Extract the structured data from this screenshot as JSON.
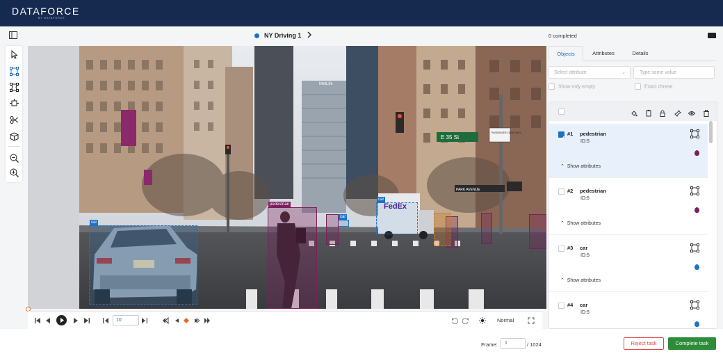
{
  "app": {
    "logo": "DATAFORCE",
    "logo_sub": "BY DATAFORCE"
  },
  "header": {
    "task_title": "NY Driving 1",
    "completed_text": "0 completed"
  },
  "toolbar": {
    "tools": [
      "cursor-icon",
      "bounding-box-icon",
      "polygon-icon",
      "keypoints-icon",
      "scissors-icon",
      "cuboid-icon",
      "zoom-out-icon",
      "zoom-in-icon"
    ]
  },
  "canvas": {
    "boxes": [
      {
        "label": "car",
        "color": "#1a73c9"
      },
      {
        "label": "pedestrian",
        "color": "#7b1f5c"
      },
      {
        "label": "car",
        "color": "#1a73c9"
      },
      {
        "label": "car",
        "color": "#1a73c9"
      },
      {
        "label": "",
        "color": "#7b1f5c"
      },
      {
        "label": "",
        "color": "#7b1f5c"
      },
      {
        "label": "",
        "color": "#7b1f5c"
      },
      {
        "label": "",
        "color": "#7b1f5c"
      },
      {
        "label": "",
        "color": "#d07a1f"
      }
    ],
    "scene_text": {
      "sign_street": "E 35 St",
      "sign_park": "PARK AVENUE",
      "sign_passenger": "PASSENGER CARS ONLY",
      "truck": "FedEx",
      "building": "MetLife",
      "plate": ""
    }
  },
  "player": {
    "frame_step": "10",
    "speed": "Normal"
  },
  "footer": {
    "frame_label": "Frame:",
    "frame_value": "1",
    "frame_total": "/ 1024",
    "reject_label": "Reject task",
    "complete_label": "Complete task"
  },
  "panel": {
    "tabs": [
      "Objects",
      "Attributes",
      "Details"
    ],
    "active_tab": "Objects",
    "select_placeholder": "Select attribute",
    "value_placeholder": "Type some value",
    "show_only_empty": "Show only empty",
    "exact_phrase": "Exact chrase",
    "objects": [
      {
        "num": "#1",
        "class": "pedestrian",
        "id": "ID:5",
        "color": "#7b1f5c",
        "toggle": "Show attributes",
        "checked": true
      },
      {
        "num": "#2",
        "class": "pedestrian",
        "id": "ID:5",
        "color": "#7b1f5c",
        "toggle": "Show attributes",
        "checked": false
      },
      {
        "num": "#3",
        "class": "car",
        "id": "ID:5",
        "color": "#1a73c9",
        "toggle": "Show attributes",
        "checked": false
      },
      {
        "num": "#4",
        "class": "car",
        "id": "ID:5",
        "color": "#1a73c9",
        "toggle": "",
        "checked": false
      }
    ]
  },
  "colors": {
    "navbar": "#162a4f",
    "accent": "#1e6fbf",
    "reject": "#e04a4a",
    "complete": "#2e8b3a"
  }
}
